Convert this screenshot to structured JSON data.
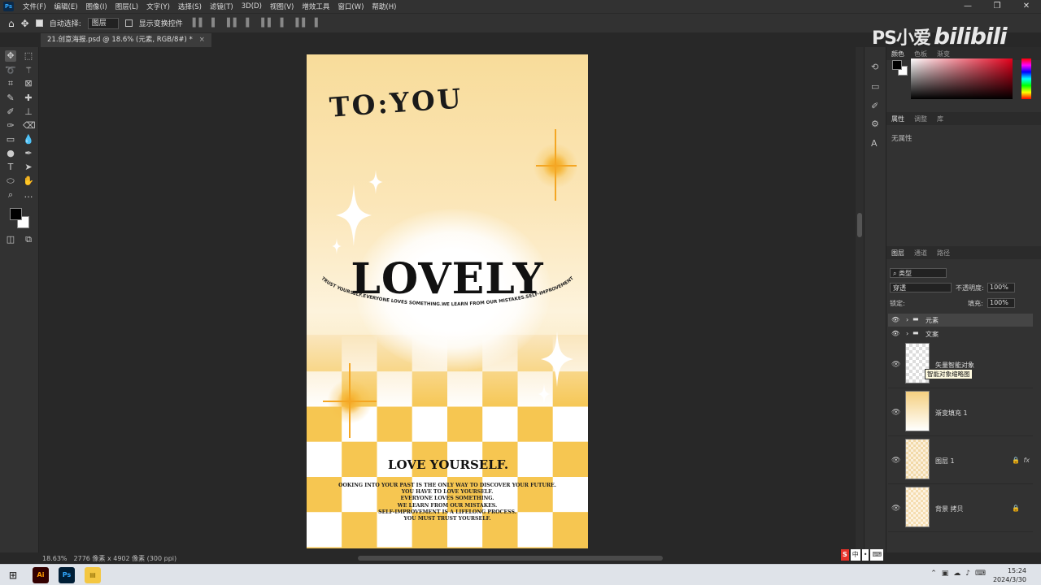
{
  "app": {
    "logo": "Ps"
  },
  "menu": [
    "文件(F)",
    "编辑(E)",
    "图像(I)",
    "图层(L)",
    "文字(Y)",
    "选择(S)",
    "滤镜(T)",
    "3D(D)",
    "视图(V)",
    "增效工具",
    "窗口(W)",
    "帮助(H)"
  ],
  "window_controls": [
    "—",
    "❐",
    "✕"
  ],
  "options": {
    "auto_select_label": "自动选择:",
    "auto_select_value": "图层",
    "show_transform_label": "显示变换控件"
  },
  "document": {
    "tab_title": "21.创意海报.psd @ 18.6% (元素, RGB/8#) *",
    "close": "×"
  },
  "poster": {
    "to_you": "TO:YOU",
    "lovely": "LOVELY",
    "ring_text": "TRUST YOURSELF.EVERYONE LOVES SOMETHING.WE LEARN FROM OUR MISTAKES.SELF-IMPROVEMENT IS A LIFELONG PROCESS.YOU MUST TRUST YO",
    "love_yourself": "LOVE YOURSELF.",
    "body_lines": [
      "OOKING INTO YOUR PAST IS THE ONLY WAY TO DISCOVER YOUR FUTURE.",
      "YOU HAVE TO LOVE YOURSELF.",
      "EVERYONE LOVES SOMETHING.",
      "WE LEARN FROM OUR MISTAKES.",
      "SELF-IMPROVEMENT IS A LIFELONG PROCESS.",
      "YOU MUST TRUST YOURSELF."
    ],
    "colors": {
      "sun": "#f4a623",
      "checker_yellow": "#f6c651",
      "bg_top": "#f8dc9a"
    }
  },
  "watermark": {
    "text": "PS小爱",
    "brand": "bilibili"
  },
  "panels": {
    "color_tabs": [
      "颜色",
      "色板",
      "渐变"
    ],
    "props_tabs": [
      "属性",
      "调整",
      "库"
    ],
    "no_props": "无属性",
    "layer_tabs": [
      "图层",
      "通道",
      "路径"
    ],
    "kind_filter": "类型",
    "blend_mode": "穿透",
    "opacity_label": "不透明度:",
    "opacity_value": "100%",
    "lock_label": "锁定:",
    "fill_label": "填充:",
    "fill_value": "100%"
  },
  "layers": {
    "groups": [
      {
        "name": "元素"
      },
      {
        "name": "文案"
      }
    ],
    "items": [
      {
        "name": "矢量智能对象"
      },
      {
        "name": "渐变填充 1"
      },
      {
        "name": "图层 1"
      },
      {
        "name": "背景 拷贝"
      }
    ],
    "tooltip": "智能对象缩略图",
    "fx": "fx"
  },
  "status": {
    "zoom": "18.63%",
    "doc_size": "2776 像素 x 4902 像素 (300 ppi)"
  },
  "taskbar": {
    "apps": [
      "Ai",
      "Ps"
    ],
    "ime": [
      "S",
      "中",
      "•",
      "⌨"
    ],
    "time": "15:24",
    "date": "2024/3/30"
  }
}
